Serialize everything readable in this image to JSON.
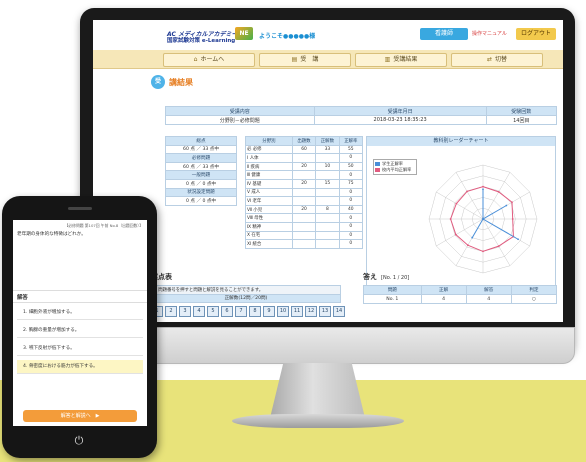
{
  "header": {
    "logo_mark": "AC メディカルアカデミー",
    "logo_text": "国家試験対策 e-Learning",
    "logo_badge": "NE",
    "welcome": "ようこそ●●●●●様",
    "user_label": "看護師",
    "manual_link": "操作マニュアル",
    "logout_label": "ログアウト"
  },
  "nav": {
    "home": "ホームへ",
    "course": "受　講",
    "history": "受講結果",
    "switch": "切替"
  },
  "page_title": "講結果",
  "info_table": {
    "headers": [
      "受講内容",
      "受講年月日",
      "受験回数"
    ],
    "row": [
      "分野別－必修問題",
      "2018-03-23 18:35:23",
      "14回目"
    ]
  },
  "score_box": {
    "rows": [
      {
        "label": "総点",
        "value": "60 点 ／ 33 点中"
      },
      {
        "label": "必修問題",
        "value": "60 点 ／ 33 点中"
      },
      {
        "label": "一般問題",
        "value": "0 点 ／ 0 点中"
      },
      {
        "label": "状況設定問題",
        "value": "0 点 ／ 0 点中"
      }
    ]
  },
  "field_table": {
    "headers": [
      "分野別",
      "出題数",
      "正解数",
      "正解率"
    ],
    "rows": [
      [
        "必 必修",
        "60",
        "33",
        "55"
      ],
      [
        "Ⅰ 人体",
        "",
        "",
        "0"
      ],
      [
        "Ⅱ 疾病",
        "20",
        "10",
        "50"
      ],
      [
        "Ⅲ 健康",
        "",
        "",
        "0"
      ],
      [
        "Ⅳ 基礎",
        "20",
        "15",
        "75"
      ],
      [
        "Ⅴ 成人",
        "",
        "",
        "0"
      ],
      [
        "Ⅵ 老年",
        "",
        "",
        "0"
      ],
      [
        "Ⅶ 小児",
        "20",
        "8",
        "40"
      ],
      [
        "Ⅷ 母性",
        "",
        "",
        "0"
      ],
      [
        "Ⅸ 精神",
        "",
        "",
        "0"
      ],
      [
        "Ⅹ 在宅",
        "",
        "",
        "0"
      ],
      [
        "Ⅺ 統合",
        "",
        "",
        "0"
      ]
    ]
  },
  "radar": {
    "title": "教科別レーダーチャート",
    "legend_self": "学生正解率",
    "legend_avg": "校内平均正解率",
    "color_self": "#4a8fd8",
    "color_avg": "#e15b7f",
    "self_values": [
      55,
      0,
      50,
      0,
      75,
      0,
      0,
      40,
      0,
      0,
      0,
      0
    ],
    "avg_values": [
      60,
      58,
      62,
      55,
      65,
      58,
      60,
      56,
      58,
      60,
      57,
      59
    ]
  },
  "scoring": {
    "heading": "採点表",
    "note": "1 問題番号を押すと問題と解説を見ることができます。",
    "header": "正解数(12問／20問)",
    "cells": [
      "1",
      "2",
      "3",
      "4",
      "5",
      "6",
      "7",
      "8",
      "9",
      "10",
      "11",
      "12",
      "13",
      "14"
    ]
  },
  "answer": {
    "heading": "答え",
    "counter": "[No. 1 / 20]",
    "headers": [
      "問題",
      "正解",
      "解答",
      "判定"
    ],
    "row": [
      "No. 1",
      "4",
      "4",
      "○"
    ]
  },
  "phone": {
    "meta": "【必修問題 第107回 午前 No.8（出題回数）】",
    "question": "老年期の身体的な特徴はどれか。",
    "section": "解答",
    "options": [
      "1. 細胞外液が増加する。",
      "2. 胸腺の重量が増加する。",
      "3. 嚥下反射が低下する。",
      "4. 骨密度における筋力が低下する。"
    ],
    "selected_index": 3,
    "next_label": "解答と解説へ　▶"
  }
}
